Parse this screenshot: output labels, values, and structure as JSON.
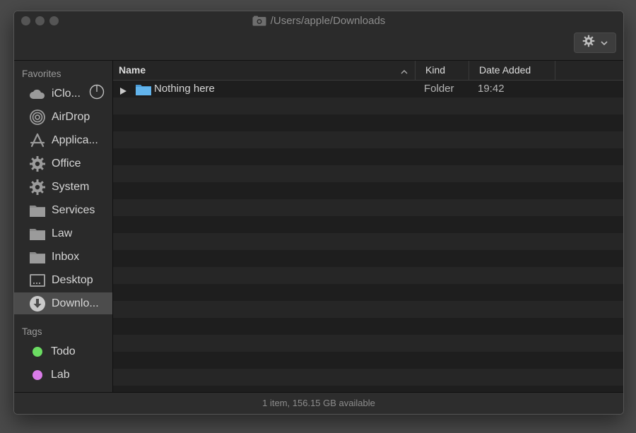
{
  "window": {
    "title": "/Users/apple/Downloads",
    "title_icon": "camera-folder-icon"
  },
  "toolbar": {
    "action_icon": "gear-icon"
  },
  "sidebar": {
    "favorites_title": "Favorites",
    "favorites": [
      {
        "label": "iClo...",
        "icon": "cloud-icon"
      },
      {
        "label": "AirDrop",
        "icon": "airdrop-icon"
      },
      {
        "label": "Applica...",
        "icon": "applications-icon"
      },
      {
        "label": "Office",
        "icon": "gear-icon"
      },
      {
        "label": "System",
        "icon": "gear-icon"
      },
      {
        "label": "Services",
        "icon": "folder-icon"
      },
      {
        "label": "Law",
        "icon": "folder-icon"
      },
      {
        "label": "Inbox",
        "icon": "folder-icon"
      },
      {
        "label": "Desktop",
        "icon": "desktop-icon"
      },
      {
        "label": "Downlo...",
        "icon": "downloads-icon",
        "selected": true
      }
    ],
    "tags_title": "Tags",
    "tags": [
      {
        "label": "Todo",
        "color": "#6bdc62"
      },
      {
        "label": "Lab",
        "color": "#d97be8"
      }
    ]
  },
  "columns": {
    "name": "Name",
    "kind": "Kind",
    "date_added": "Date Added"
  },
  "files": [
    {
      "name": "Nothing here",
      "kind": "Folder",
      "date_added": "19:42",
      "icon": "folder-icon",
      "color": "#5aaee6"
    }
  ],
  "status": {
    "text": "1 item, 156.15 GB available"
  }
}
